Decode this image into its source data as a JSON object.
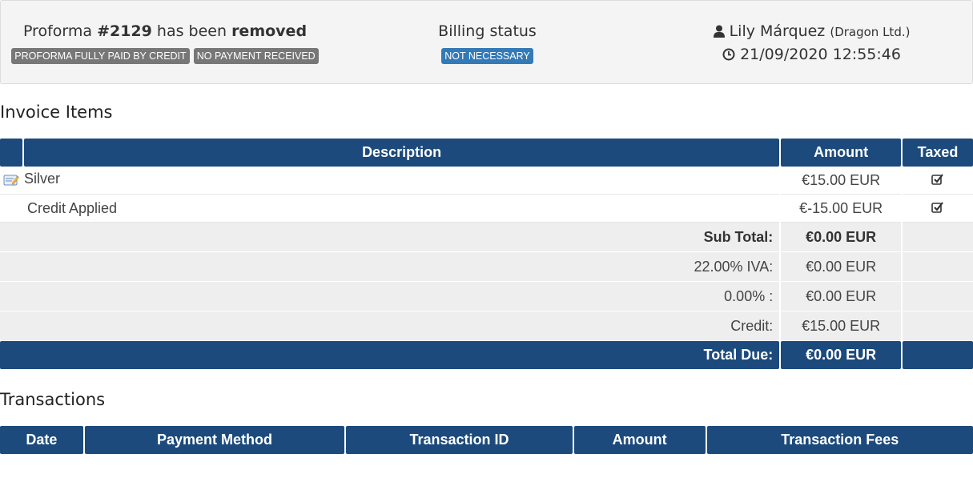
{
  "header": {
    "proforma_prefix": "Proforma ",
    "proforma_number": "#2129",
    "proforma_mid": " has been ",
    "proforma_action": "removed",
    "badges": [
      "PROFORMA FULLY PAID BY CREDIT",
      "NO PAYMENT RECEIVED"
    ],
    "billing_title": "Billing status",
    "billing_badge": "NOT NECESSARY",
    "user_name": "Lily Márquez",
    "company": "(Dragon Ltd.)",
    "datetime": "21/09/2020 12:55:46"
  },
  "invoice_items": {
    "title": "Invoice Items",
    "columns": [
      "",
      "Description",
      "Amount",
      "Taxed"
    ],
    "rows": [
      {
        "description": "Silver",
        "amount": "€15.00 EUR",
        "taxed": true,
        "icon": "edit-icon"
      },
      {
        "description": "Credit Applied",
        "amount": "€-15.00 EUR",
        "taxed": true
      }
    ],
    "totals": [
      {
        "label": "Sub Total:",
        "value": "€0.00 EUR",
        "bold": true
      },
      {
        "label": "22.00% IVA:",
        "value": "€0.00 EUR"
      },
      {
        "label": "0.00% :",
        "value": "€0.00 EUR"
      },
      {
        "label": "Credit:",
        "value": "€15.00 EUR"
      }
    ],
    "total_due": {
      "label": "Total Due:",
      "value": "€0.00 EUR"
    }
  },
  "transactions": {
    "title": "Transactions",
    "columns": [
      "Date",
      "Payment Method",
      "Transaction ID",
      "Amount",
      "Transaction Fees"
    ]
  },
  "colors": {
    "header_bg": "#1c4a7c",
    "badge_gray": "#777777",
    "badge_blue": "#337ab7"
  }
}
